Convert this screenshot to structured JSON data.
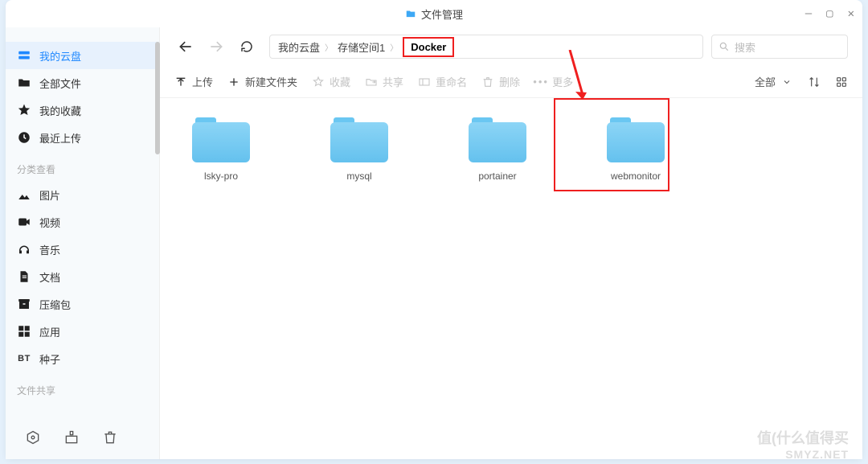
{
  "title": "文件管理",
  "window_controls": {
    "min": "—",
    "max": "▢",
    "close": "✕"
  },
  "sidebar": {
    "items": [
      {
        "label": "我的云盘",
        "active": true
      },
      {
        "label": "全部文件"
      },
      {
        "label": "我的收藏"
      },
      {
        "label": "最近上传"
      }
    ],
    "section1_title": "分类查看",
    "categories": [
      {
        "label": "图片"
      },
      {
        "label": "视频"
      },
      {
        "label": "音乐"
      },
      {
        "label": "文档"
      },
      {
        "label": "压缩包"
      },
      {
        "label": "应用"
      },
      {
        "label": "种子",
        "prefix": "BT"
      }
    ],
    "section2_title": "文件共享"
  },
  "breadcrumb": {
    "parts": [
      "我的云盘",
      "存储空间1",
      "Docker"
    ]
  },
  "search_placeholder": "搜索",
  "toolbar": {
    "upload": "上传",
    "newfolder": "新建文件夹",
    "fav": "收藏",
    "share": "共享",
    "rename": "重命名",
    "delete": "删除",
    "more": "更多",
    "filter_all": "全部"
  },
  "folders": [
    {
      "name": "lsky-pro"
    },
    {
      "name": "mysql"
    },
    {
      "name": "portainer"
    },
    {
      "name": "webmonitor"
    }
  ],
  "watermark_top": "值(什么值得买",
  "watermark_bottom": "SMYZ.NET"
}
